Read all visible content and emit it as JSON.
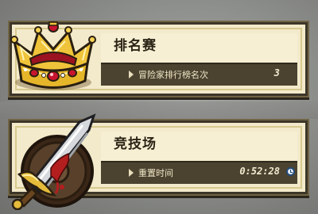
{
  "rank_card": {
    "title": "排名赛",
    "info_label": "冒险家排行榜名次",
    "info_value": "3",
    "icon": "crown-icon"
  },
  "arena_card": {
    "title": "竞技场",
    "info_label": "重置时间",
    "info_value": "0:52:28",
    "icon": "sword-shield-icon",
    "status_icon": "clock-icon"
  },
  "colors": {
    "card_bg": "#f3eacb",
    "bar_bg": "#4b4330",
    "border": "#3d3629",
    "gold": "#e8b923",
    "ruby": "#b3122a"
  }
}
